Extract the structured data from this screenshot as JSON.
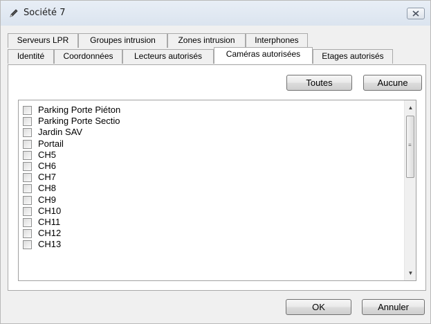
{
  "window": {
    "title": "Société 7"
  },
  "tabs_row1": [
    {
      "label": "Serveurs LPR"
    },
    {
      "label": "Groupes intrusion"
    },
    {
      "label": "Zones intrusion"
    },
    {
      "label": "Interphones"
    }
  ],
  "tabs_row2": [
    {
      "label": "Identité"
    },
    {
      "label": "Coordonnées"
    },
    {
      "label": "Lecteurs autorisés"
    },
    {
      "label": "Caméras autorisées",
      "active": true
    },
    {
      "label": "Etages autorisés"
    }
  ],
  "panel": {
    "all_label": "Toutes",
    "none_label": "Aucune",
    "cameras": [
      {
        "label": "Parking Porte Piéton",
        "checked": false
      },
      {
        "label": "Parking Porte Sectio",
        "checked": false
      },
      {
        "label": "Jardin SAV",
        "checked": false
      },
      {
        "label": "Portail",
        "checked": false
      },
      {
        "label": "CH5",
        "checked": false
      },
      {
        "label": "CH6",
        "checked": false
      },
      {
        "label": "CH7",
        "checked": false
      },
      {
        "label": "CH8",
        "checked": false
      },
      {
        "label": "CH9",
        "checked": false
      },
      {
        "label": "CH10",
        "checked": false
      },
      {
        "label": "CH11",
        "checked": false
      },
      {
        "label": "CH12",
        "checked": false
      },
      {
        "label": "CH13",
        "checked": false
      }
    ]
  },
  "footer": {
    "ok_label": "OK",
    "cancel_label": "Annuler"
  }
}
